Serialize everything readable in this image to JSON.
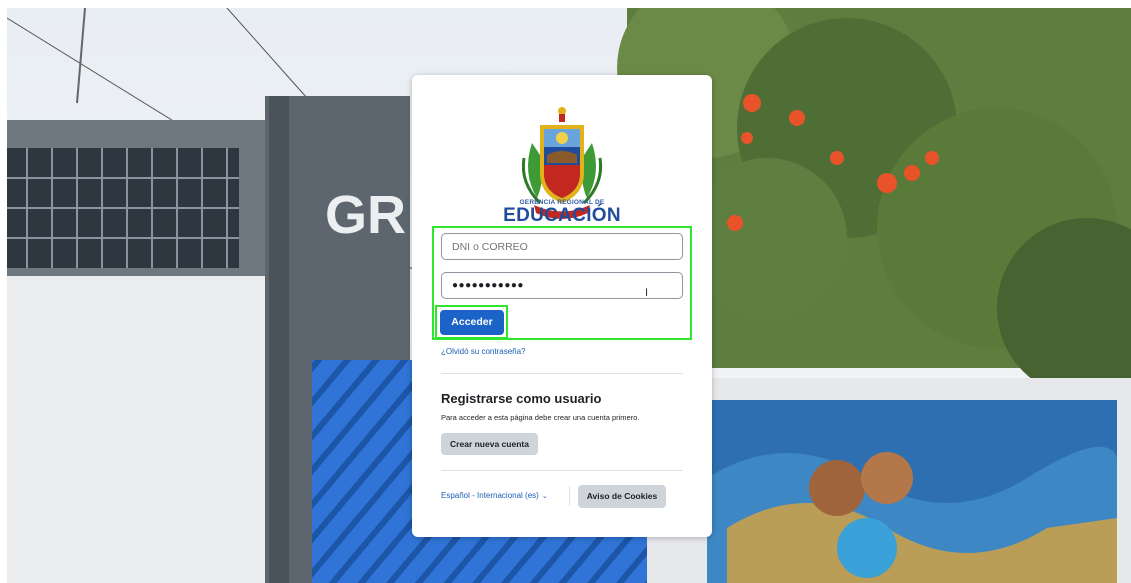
{
  "logo": {
    "line1": "GERENCIA REGIONAL DE",
    "line2": "EDUCACIÓN"
  },
  "background": {
    "building_sign": "GR"
  },
  "login": {
    "username_placeholder": "DNI o CORREO",
    "password_mask": "●●●●●●●●●●●",
    "submit_label": "Acceder",
    "forgot_link": "¿Olvidó su contraseña?"
  },
  "register": {
    "title": "Registrarse como usuario",
    "description": "Para acceder a esta página debe crear una cuenta primero.",
    "button_label": "Crear nueva cuenta"
  },
  "footer": {
    "language_label": "Español - Internacional (es)",
    "language_chevron": "⌄",
    "cookies_label": "Aviso de Cookies"
  },
  "cursor": {
    "glyph": "I"
  },
  "colors": {
    "primary": "#1b63c6",
    "link": "#1a60b6",
    "highlight": "#2ee62e",
    "secondary_button": "#ced4da"
  }
}
